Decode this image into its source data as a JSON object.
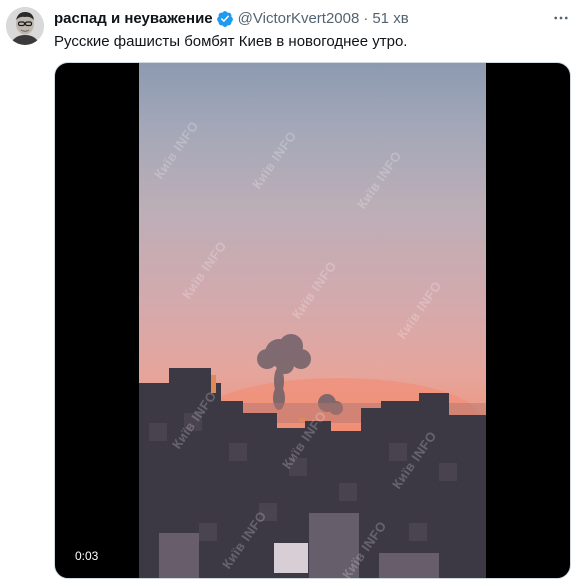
{
  "author": {
    "display_name": "распад и неуважение",
    "verified": true,
    "handle": "@VictorKvert2008",
    "separator": "·",
    "timestamp": "51 хв"
  },
  "tweet": {
    "text": "Русские фашисты бомбят Киев в новогоднее утро."
  },
  "media": {
    "type": "video",
    "duration_label": "0:03",
    "watermark_text": "Київ INFO"
  },
  "icons": {
    "avatar": "avatar-photo",
    "verified": "verified-badge-icon",
    "more": "more-options-icon"
  },
  "colors": {
    "verified": "#1d9bf0",
    "secondary_text": "#536471",
    "primary_text": "#0f1419",
    "sky_top": "#8c9ab0",
    "sky_horizon": "#ef9680"
  }
}
